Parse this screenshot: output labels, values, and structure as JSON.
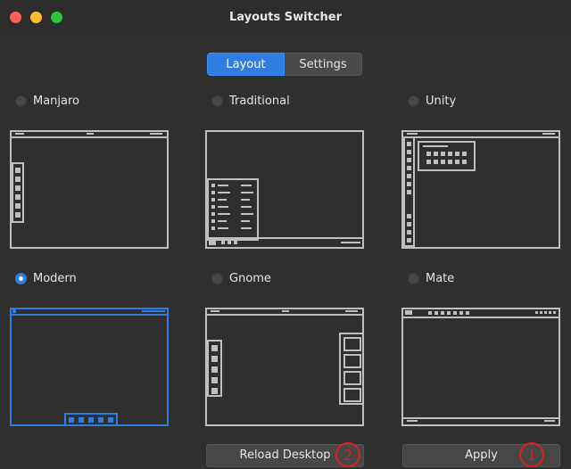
{
  "window": {
    "title": "Layouts Switcher"
  },
  "tabs": [
    {
      "label": "Layout",
      "active": true
    },
    {
      "label": "Settings",
      "active": false
    }
  ],
  "layouts": [
    {
      "label": "Manjaro",
      "selected": false
    },
    {
      "label": "Traditional",
      "selected": false
    },
    {
      "label": "Unity",
      "selected": false
    },
    {
      "label": "Modern",
      "selected": true
    },
    {
      "label": "Gnome",
      "selected": false
    },
    {
      "label": "Mate",
      "selected": false
    }
  ],
  "buttons": {
    "reload": "Reload Desktop",
    "apply": "Apply"
  },
  "callouts": {
    "reload": "2",
    "apply": "1"
  },
  "colors": {
    "accent": "#2f7de1",
    "callout": "#e02020",
    "background": "#2f2f2f"
  }
}
